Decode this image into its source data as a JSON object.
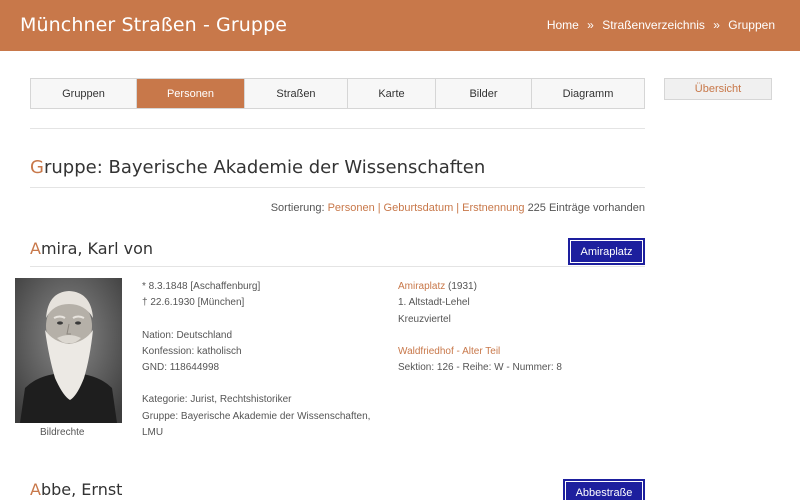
{
  "header": {
    "site_title": "Münchner Straßen - Gruppe",
    "breadcrumb": [
      "Home",
      "Straßenverzeichnis",
      "Gruppen"
    ],
    "breadcrumb_sep": "»"
  },
  "tabs": [
    {
      "label": "Gruppen",
      "active": false
    },
    {
      "label": "Personen",
      "active": true
    },
    {
      "label": "Straßen",
      "active": false
    },
    {
      "label": "Karte",
      "active": false
    },
    {
      "label": "Bilder",
      "active": false
    },
    {
      "label": "Diagramm",
      "active": false
    }
  ],
  "overview_button": "Übersicht",
  "group": {
    "initial": "G",
    "rest": "ruppe: Bayerische Akademie der Wissenschaften"
  },
  "sorting": {
    "prefix": "Sortierung:",
    "options": [
      "Personen",
      "Geburtsdatum",
      "Erstnennung"
    ],
    "sep": "|",
    "count": "225 Einträge vorhanden"
  },
  "persons": [
    {
      "initial": "A",
      "name_rest": "mira, Karl von",
      "sign": "Amiraplatz",
      "photo_credit": "Bildrechte",
      "born": "* 8.3.1848 [Aschaffenburg]",
      "died": "† 22.6.1930 [München]",
      "nation": "Nation: Deutschland",
      "confession": "Konfession: katholisch",
      "gnd": "GND: 118644998",
      "category": "Kategorie: Jurist, Rechtshistoriker",
      "group_line1": "Gruppe: Bayerische Akademie der Wissenschaften,",
      "group_line2": "LMU",
      "street_link": "Amiraplatz",
      "street_year": "(1931)",
      "district": "1. Altstadt-Lehel",
      "quarter": "Kreuzviertel",
      "cemetery_link": "Waldfriedhof - Alter Teil",
      "grave": "Sektion: 126 - Reihe: W - Nummer: 8"
    },
    {
      "initial": "A",
      "name_rest": "bbe, Ernst",
      "sign": "Abbestraße"
    }
  ]
}
